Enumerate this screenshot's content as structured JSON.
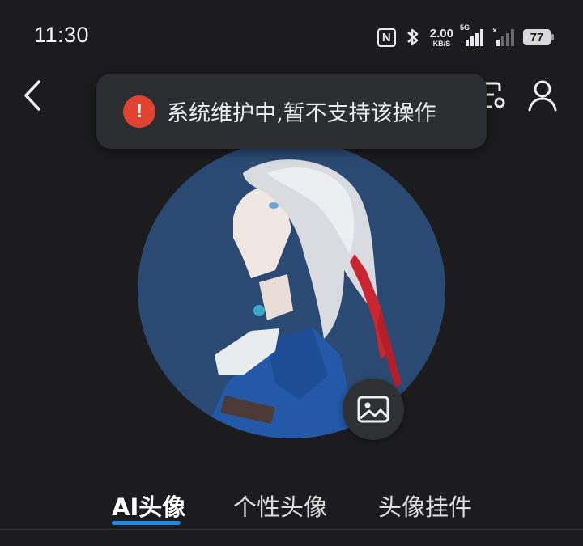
{
  "status_bar": {
    "time": "11:30",
    "net_speed_value": "2.00",
    "net_speed_unit": "KB/S",
    "signal_label": "5G",
    "battery": "77",
    "icons": [
      "nfc-icon",
      "bluetooth-icon",
      "signal-5g-icon",
      "signal-no-service-icon",
      "battery-icon"
    ]
  },
  "header": {
    "back_icon": "chevron-left-icon",
    "scan_icon": "scan-icon",
    "profile_icon": "user-icon"
  },
  "toast": {
    "icon": "!",
    "message": "系统维护中,暂不支持该操作",
    "accent": "#e0432f"
  },
  "avatar": {
    "edit_icon": "image-icon"
  },
  "tabs": [
    {
      "label": "AI头像",
      "active": true
    },
    {
      "label": "个性头像",
      "active": false
    },
    {
      "label": "头像挂件",
      "active": false
    }
  ],
  "colors": {
    "background": "#1c1c1e",
    "tab_indicator": "#1e88e5",
    "avatar_bg": "#2b4a73"
  }
}
